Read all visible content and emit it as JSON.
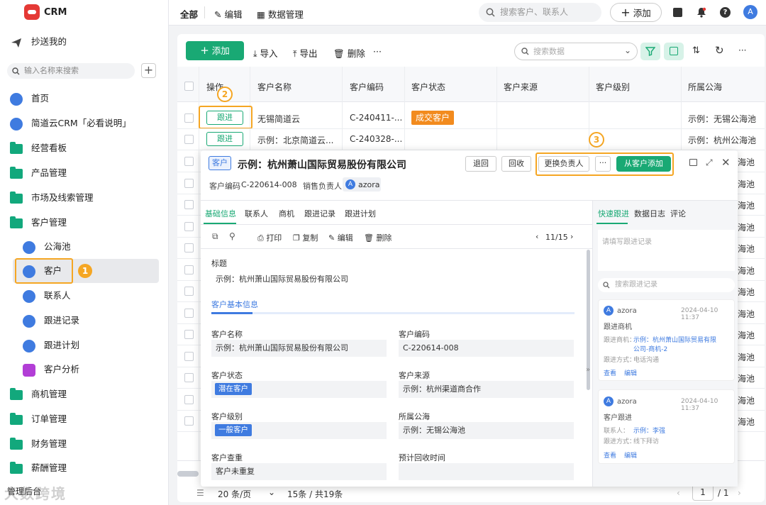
{
  "app": {
    "name": "CRM"
  },
  "sidebar": {
    "cc_me": "抄送我的",
    "search_placeholder": "输入名称来搜索",
    "items": [
      {
        "label": "首页"
      },
      {
        "label": "简道云CRM「必看说明」"
      },
      {
        "label": "经营看板"
      },
      {
        "label": "产品管理"
      },
      {
        "label": "市场及线索管理"
      },
      {
        "label": "客户管理"
      },
      {
        "label": "公海池"
      },
      {
        "label": "客户"
      },
      {
        "label": "联系人"
      },
      {
        "label": "跟进记录"
      },
      {
        "label": "跟进计划"
      },
      {
        "label": "客户分析"
      },
      {
        "label": "商机管理"
      },
      {
        "label": "订单管理"
      },
      {
        "label": "财务管理"
      },
      {
        "label": "薪酬管理"
      },
      {
        "label": "管理后台"
      }
    ],
    "watermark": "大数跨境",
    "markers": {
      "m1": "1",
      "m2": "2",
      "m3": "3"
    }
  },
  "topbar": {
    "all": "全部",
    "edit": "编辑",
    "data_mgmt": "数据管理",
    "search_placeholder": "搜索客户、联系人",
    "add": "添加",
    "avatar": "A"
  },
  "toolbar": {
    "add": "添加",
    "import": "导入",
    "export": "导出",
    "delete": "删除",
    "more": "···",
    "search_placeholder": "搜索数据"
  },
  "table": {
    "headers": [
      "操作",
      "客户名称",
      "客户编码",
      "客户状态",
      "客户来源",
      "客户级别",
      "所属公海"
    ],
    "follow_label": "跟进",
    "rows": [
      {
        "name": "无锡简道云",
        "code": "C-240411-...",
        "status": "成交客户",
        "pool": "示例：无锡公海池"
      },
      {
        "name": "示例：北京简道云...",
        "code": "C-240328-...",
        "status": "",
        "pool": "示例：杭州公海池"
      }
    ],
    "pool_col_rest": [
      "海池",
      "海池",
      "海池",
      "海池",
      "海池",
      "海池",
      "海池",
      "海池",
      "海池",
      "海池",
      "海池",
      "海池",
      "海池"
    ]
  },
  "detail": {
    "type_tag": "客户",
    "title": "示例：杭州萧山国际贸易股份有限公司",
    "buttons": {
      "back": "退回",
      "recycle": "回收",
      "change_owner": "更换负责人",
      "more": "···",
      "add_from_customer": "从客户添加"
    },
    "code_label": "客户编码",
    "code_value": "C-220614-008",
    "owner_label": "销售负责人",
    "owner_name": "azora",
    "owner_avatar": "A",
    "tabs": [
      "基础信息",
      "联系人",
      "商机",
      "跟进记录",
      "跟进计划"
    ],
    "actions": {
      "print": "打印",
      "copy": "复制",
      "edit": "编辑",
      "delete": "删除",
      "pager": "11/15"
    },
    "title_label": "标题",
    "title_value": "示例：杭州萧山国际贸易股份有限公司",
    "section": "客户基本信息",
    "fields": {
      "name_label": "客户名称",
      "name_value": "示例：杭州萧山国际贸易股份有限公司",
      "code_label": "客户编码",
      "code_value": "C-220614-008",
      "status_label": "客户状态",
      "status_value": "潜在客户",
      "source_label": "客户来源",
      "source_value": "示例：杭州渠道商合作",
      "level_label": "客户级别",
      "level_value": "一般客户",
      "pool_label": "所属公海",
      "pool_value": "示例：无锡公海池",
      "dup_label": "客户查重",
      "dup_value": "客户未重复",
      "recycle_label": "预计回收时间"
    },
    "right_tabs": [
      "快速跟进",
      "数据日志",
      "评论"
    ],
    "quick_placeholder": "请填写跟进记录",
    "search_placeholder": "搜索跟进记录",
    "records": [
      {
        "user": "azora",
        "time": "2024-04-10 11:37",
        "type": "跟进商机",
        "l1": "跟进商机：",
        "v1a": "示例：杭州萧山国际贸易有限",
        "v1b": "公司-商机-2",
        "l2": "跟进方式：",
        "v2": "电话沟通",
        "view": "查看",
        "edit": "编辑"
      },
      {
        "user": "azora",
        "time": "2024-04-10 11:37",
        "type": "客户跟进",
        "l1": "联系人：",
        "v1a": "示例：李强",
        "l2": "跟进方式：",
        "v2": "线下拜访",
        "view": "查看",
        "edit": "编辑"
      }
    ]
  },
  "footer": {
    "page_size": "20 条/页",
    "count": "15条 / 共19条",
    "page": "1",
    "total": "/ 1"
  }
}
